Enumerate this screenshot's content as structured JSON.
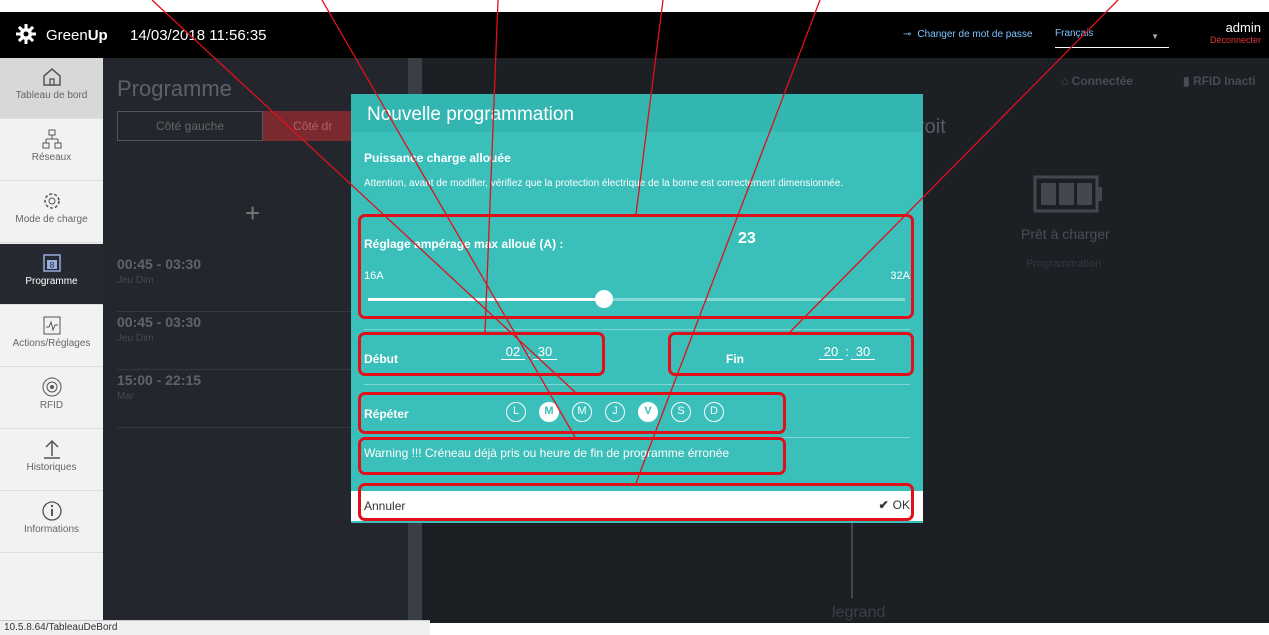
{
  "header": {
    "brand_light": "Green",
    "brand_bold": "Up",
    "datetime": "14/03/2018 11:56:35",
    "change_password": "Changer de mot de passe",
    "language": "Français",
    "user": "admin",
    "logout": "Déconnecter"
  },
  "sidebar": {
    "items": [
      {
        "label": "Tableau de bord",
        "icon": "home-icon"
      },
      {
        "label": "Réseaux",
        "icon": "network-icon"
      },
      {
        "label": "Mode de charge",
        "icon": "gear-icon"
      },
      {
        "label": "Programme",
        "icon": "calendar-icon"
      },
      {
        "label": "Actions/Réglages",
        "icon": "pulse-icon"
      },
      {
        "label": "RFID",
        "icon": "rfid-icon"
      },
      {
        "label": "Historiques",
        "icon": "upload-arrow-icon"
      },
      {
        "label": "Informations",
        "icon": "info-icon"
      }
    ]
  },
  "program": {
    "title": "Programme",
    "tab_left": "Côté gauche",
    "tab_right": "Côté dr",
    "slots": [
      {
        "time": "00:45 - 03:30",
        "days": "Jeu Dim"
      },
      {
        "time": "00:45 - 03:30",
        "days": "Jeu Dim"
      },
      {
        "time": "15:00 - 22:15",
        "days": "Mar"
      }
    ]
  },
  "right_panel": {
    "side_title": "roit",
    "connected": "Connectée",
    "rfid": "RFID Inacti",
    "ready": "Prêt à charger",
    "programming": "Programmation",
    "brand_footer": "legrand"
  },
  "dialog": {
    "title": "Nouvelle programmation",
    "section": "Puissance charge allouée",
    "warning": "Attention, avant de modifier, vérifiez que la protection électrique de la borne est correctement dimensionnée.",
    "amp_label": "Réglage ampérage max alloué (A) :",
    "amp_value": "23",
    "amp_min": "16A",
    "amp_max": "32A",
    "slider_fraction": 0.44,
    "start_label": "Début",
    "start_h": "02",
    "start_m": "30",
    "end_label": "Fin",
    "end_h": "20",
    "end_m": "30",
    "repeat_label": "Répéter",
    "days": [
      {
        "letter": "L",
        "selected": false
      },
      {
        "letter": "M",
        "selected": true
      },
      {
        "letter": "M",
        "selected": false
      },
      {
        "letter": "J",
        "selected": false
      },
      {
        "letter": "V",
        "selected": true
      },
      {
        "letter": "S",
        "selected": false
      },
      {
        "letter": "D",
        "selected": false
      }
    ],
    "error": "Warning !!! Créneau déjà pris ou heure de fin de programme érronée",
    "cancel": "Annuler",
    "ok": "OK"
  },
  "status_url": "10.5.8.64/TableauDeBord",
  "colors": {
    "teal": "#3bbfba",
    "annotation_red": "#e0101a"
  }
}
